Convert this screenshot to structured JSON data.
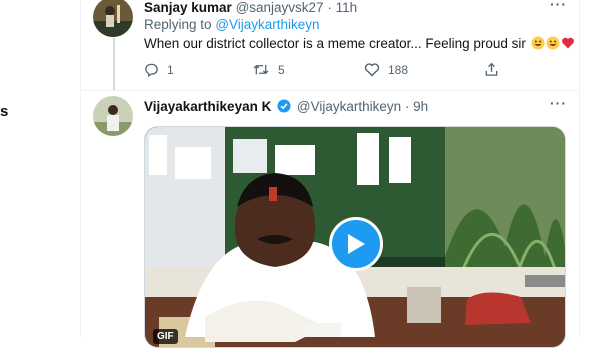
{
  "sidebar": {
    "fragment_text": "s"
  },
  "tweets": [
    {
      "name": "Sanjay kumar",
      "handle": "@sanjayvsk27",
      "separator": "·",
      "time": "11h",
      "replying_prefix": "Replying to",
      "replying_to": "@Vijaykarthikeyn",
      "text": "When our district collector is a meme creator... Feeling proud sir",
      "emojis": [
        "grinning-face",
        "grinning-face",
        "red-heart"
      ],
      "actions": {
        "reply_count": "1",
        "retweet_count": "5",
        "like_count": "188"
      }
    },
    {
      "name": "Vijayakarthikeyan K",
      "verified": true,
      "handle": "@Vijaykarthikeyn",
      "separator": "·",
      "time": "9h",
      "media": {
        "type": "gif",
        "badge": "GIF"
      }
    }
  ],
  "colors": {
    "accent": "#1d9bf0",
    "secondary_text": "#536471",
    "primary_text": "#0f1419"
  }
}
